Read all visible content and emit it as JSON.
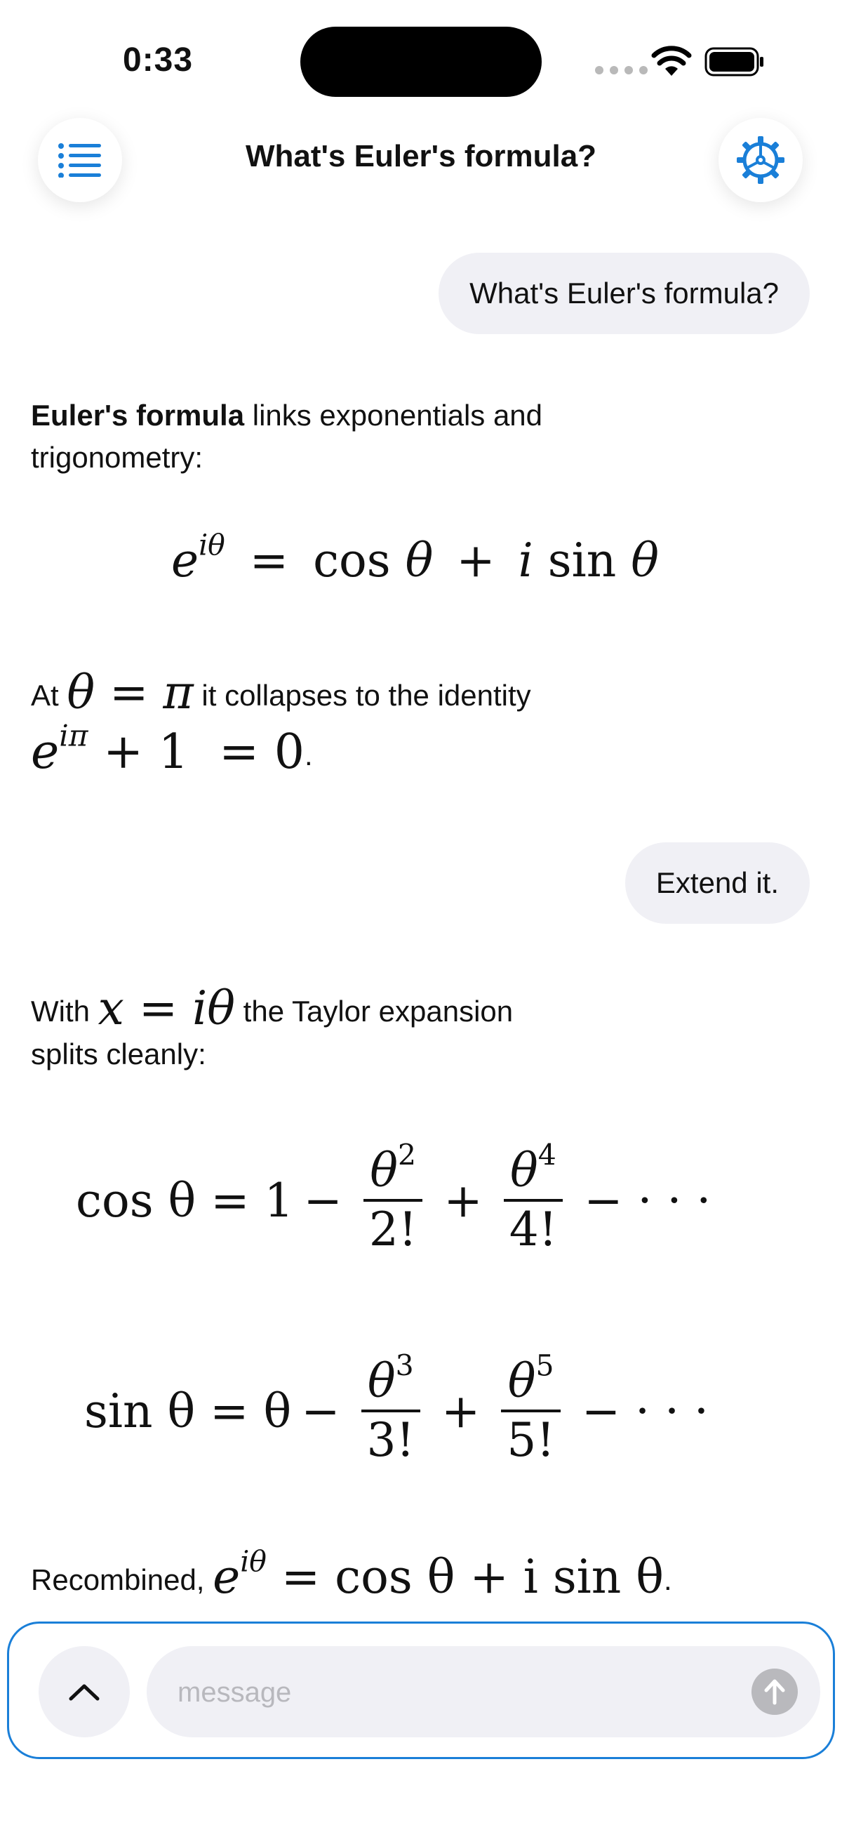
{
  "status_bar": {
    "time": "0:33"
  },
  "header": {
    "title": "What's Euler's formula?",
    "menu_icon": "list-icon",
    "settings_icon": "gear-icon",
    "accent_color": "#1a7fd8"
  },
  "messages": {
    "user_1": "What's Euler's formula?",
    "assistant_1": {
      "bold_lead": "Euler's formula",
      "text_rest": " links exponentials and trigonometry:",
      "equation": {
        "lhs_base": "e",
        "lhs_exp": "iθ",
        "eq": "=",
        "cos": "cos",
        "theta1": "θ",
        "plus": "+",
        "i": "i",
        "sin": "sin",
        "theta2": "θ"
      },
      "line2_prefix": "At ",
      "line2_math": "θ = π",
      "line2_suffix": " it collapses to the identity",
      "identity": {
        "base": "e",
        "exp": "iπ",
        "rest": " + 1  = 0",
        "period": "."
      }
    },
    "user_2": "Extend it.",
    "assistant_2": {
      "line1_prefix": "With ",
      "line1_math": "x = iθ",
      "line1_suffix": " the Taylor expansion",
      "line2": "splits cleanly:",
      "cos_series": {
        "lhs": "cos θ = 1",
        "minus1": "−",
        "frac1_num_base": "θ",
        "frac1_num_exp": "2",
        "frac1_den": "2!",
        "plus": "+",
        "frac2_num_base": "θ",
        "frac2_num_exp": "4",
        "frac2_den": "4!",
        "tail": "− · · ·"
      },
      "sin_series": {
        "lhs": "sin θ = θ",
        "minus1": "−",
        "frac1_num_base": "θ",
        "frac1_num_exp": "3",
        "frac1_den": "3!",
        "plus": "+",
        "frac2_num_base": "θ",
        "frac2_num_exp": "5",
        "frac2_den": "5!",
        "tail": "− · · ·"
      },
      "recombined_prefix": "Recombined, ",
      "recombined_base": "e",
      "recombined_exp": "iθ",
      "recombined_rest": " = cos θ + i sin θ",
      "recombined_period": "."
    }
  },
  "composer": {
    "placeholder": "message",
    "expand_icon": "chevron-up-icon",
    "send_icon": "arrow-up-icon"
  }
}
